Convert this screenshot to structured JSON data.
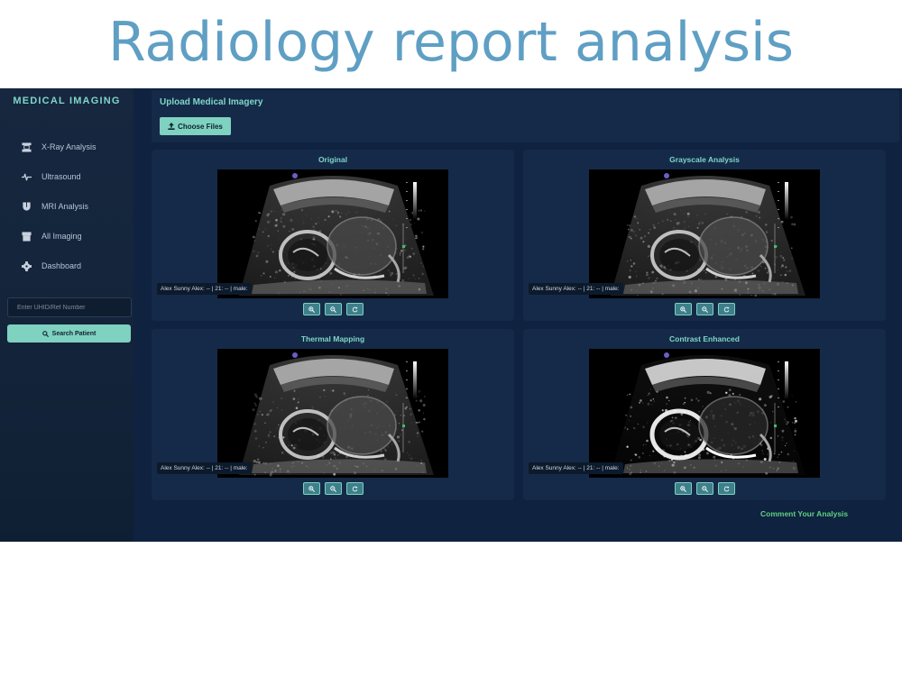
{
  "banner": {
    "title": "Radiology report analysis"
  },
  "sidebar": {
    "brand": "MEDICAL IMAGING",
    "items": [
      {
        "label": "X-Ray Analysis",
        "icon": "xray-icon"
      },
      {
        "label": "Ultrasound",
        "icon": "waveform-icon"
      },
      {
        "label": "MRI Analysis",
        "icon": "magnet-icon"
      },
      {
        "label": "All Imaging",
        "icon": "archive-icon"
      },
      {
        "label": "Dashboard",
        "icon": "gear-icon"
      }
    ],
    "search": {
      "placeholder": "Enter UHID/Ref Number",
      "button": "Search Patient"
    }
  },
  "upload": {
    "title": "Upload Medical Imagery",
    "button": "Choose Files"
  },
  "cards": [
    {
      "title": "Original",
      "patient": "Alex Sunny Alex: -- | 21: -- | male:"
    },
    {
      "title": "Grayscale Analysis",
      "patient": "Alex Sunny Alex: -- | 21: -- | male:"
    },
    {
      "title": "Thermal Mapping",
      "patient": "Alex Sunny Alex: -- | 21: -- | male:"
    },
    {
      "title": "Contrast Enhanced",
      "patient": "Alex Sunny Alex: -- | 21: -- | male:"
    }
  ],
  "footer": {
    "comment": "Comment Your Analysis"
  },
  "colors": {
    "accent": "#7fd1c0",
    "panel": "#152a48",
    "background": "#0f2240",
    "link": "#5fd07e"
  }
}
